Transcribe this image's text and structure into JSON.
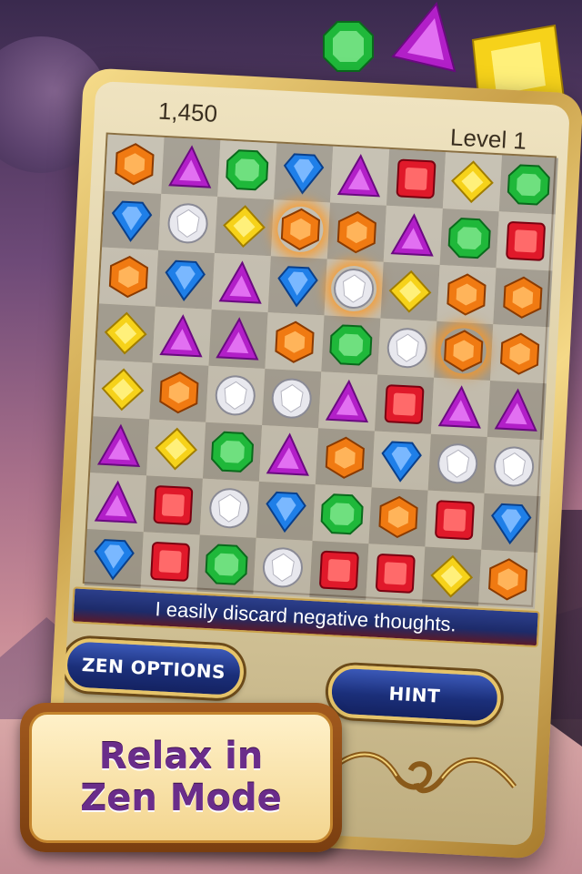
{
  "hud": {
    "score": "1,450",
    "level": "Level 1"
  },
  "board": {
    "rows": [
      [
        "orange",
        "purple",
        "green",
        "blue",
        "purple",
        "red",
        "yellow",
        "green"
      ],
      [
        "blue",
        "white",
        "yellow",
        "orange",
        "orange",
        "purple",
        "green",
        "red"
      ],
      [
        "orange",
        "blue",
        "purple",
        "blue",
        "white",
        "yellow",
        "orange",
        "orange"
      ],
      [
        "yellow",
        "purple",
        "purple",
        "orange",
        "green",
        "white",
        "orange",
        "orange"
      ],
      [
        "yellow",
        "orange",
        "white",
        "white",
        "purple",
        "red",
        "purple",
        "purple"
      ],
      [
        "purple",
        "yellow",
        "green",
        "purple",
        "orange",
        "blue",
        "white",
        "white"
      ],
      [
        "purple",
        "red",
        "white",
        "blue",
        "green",
        "orange",
        "red",
        "blue"
      ],
      [
        "blue",
        "red",
        "green",
        "white",
        "red",
        "red",
        "yellow",
        "orange"
      ]
    ],
    "burning": [
      [
        1,
        3
      ],
      [
        2,
        4
      ],
      [
        3,
        6
      ]
    ]
  },
  "affirmation": "I easily discard negative thoughts.",
  "buttons": {
    "zen_options": "ZEN OPTIONS",
    "hint": "HINT"
  },
  "promo": {
    "line1": "Relax in",
    "line2": "Zen Mode"
  },
  "colors": {
    "red": "#e0192a",
    "orange": "#f07a12",
    "yellow": "#f6d21a",
    "green": "#1fb83a",
    "blue": "#1f7fe8",
    "purple": "#b21fc8",
    "white": "#e8e8ee",
    "frame_gold": "#caa14a",
    "button_blue": "#1b2f7a",
    "promo_text": "#6a2d8a"
  },
  "floating_gems": [
    "green",
    "purple",
    "yellow"
  ]
}
